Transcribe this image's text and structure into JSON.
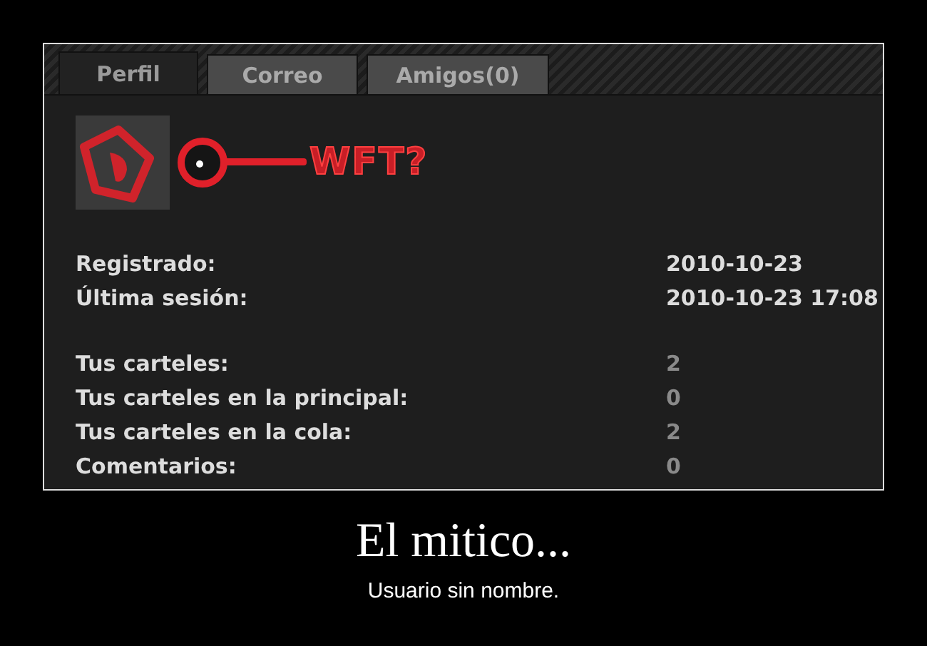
{
  "tabs": [
    {
      "label": "Perfil",
      "selected": true
    },
    {
      "label": "Correo",
      "selected": false
    },
    {
      "label": "Amigos(0)",
      "selected": false
    }
  ],
  "banner": {
    "text": "WFT?"
  },
  "stat_groups": [
    {
      "rows": [
        {
          "label": "Registrado:",
          "value": "2010-10-23"
        },
        {
          "label": "Última sesión:",
          "value": "2010-10-23 17:08"
        }
      ]
    },
    {
      "rows": [
        {
          "label": "Tus carteles:",
          "value": "2"
        },
        {
          "label": "Tus carteles en la principal:",
          "value": "0"
        },
        {
          "label": "Tus carteles en la cola:",
          "value": "2"
        },
        {
          "label": "Comentarios:",
          "value": "0"
        }
      ]
    }
  ],
  "caption": {
    "title": "El mitico...",
    "subtitle": "Usuario sin nombre."
  }
}
